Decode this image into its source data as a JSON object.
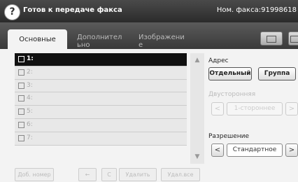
{
  "header": {
    "help_icon": "?",
    "status": "Готов к передаче факса",
    "fax_number": "Ном. факса:91998618"
  },
  "tabs": [
    {
      "label": "Основные"
    },
    {
      "label": "Дополнител\nьно"
    },
    {
      "label": "Изображени\nе"
    }
  ],
  "recipients": [
    {
      "label": "1:"
    },
    {
      "label": "2:"
    },
    {
      "label": "3:"
    },
    {
      "label": "4:"
    },
    {
      "label": "5:"
    },
    {
      "label": "6:"
    },
    {
      "label": "7:"
    }
  ],
  "scroll": {
    "up": "▲",
    "down": "▼"
  },
  "bottom_buttons": {
    "add_number": "Доб. номер",
    "back": "←",
    "clear": "C",
    "delete": "Удалить",
    "delete_all": "Удал.все"
  },
  "address": {
    "label": "Адрес",
    "individual": "Отдельный",
    "group": "Группа"
  },
  "duplex": {
    "label": "Двусторонняя",
    "value": "1-стороннее",
    "prev": "<",
    "next": ">"
  },
  "resolution": {
    "label": "Разрешение",
    "value": "Стандартное",
    "prev": "<",
    "next": ">"
  }
}
